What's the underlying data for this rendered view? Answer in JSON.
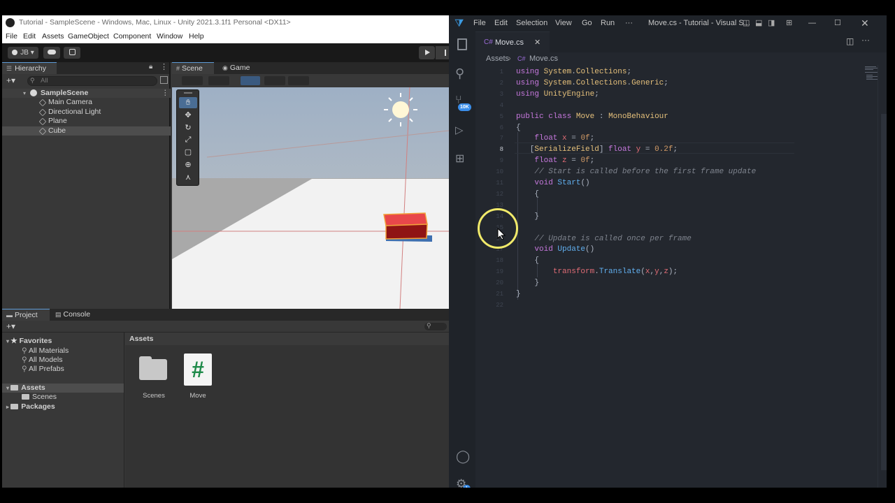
{
  "unity": {
    "title": "Tutorial - SampleScene - Windows, Mac, Linux - Unity 2021.3.1f1 Personal <DX11>",
    "menu": [
      "File",
      "Edit",
      "Assets",
      "GameObject",
      "Component",
      "Window",
      "Help"
    ],
    "account_label": "JB",
    "hierarchy": {
      "tab": "Hierarchy",
      "search_placeholder": "All",
      "scene": "SampleScene",
      "items": [
        "Main Camera",
        "Directional Light",
        "Plane",
        "Cube"
      ],
      "selected": "Cube"
    },
    "scene_tabs": [
      "Scene",
      "Game"
    ],
    "project": {
      "tabs": [
        "Project",
        "Console"
      ],
      "favorites_label": "Favorites",
      "favorites": [
        "All Materials",
        "All Models",
        "All Prefabs"
      ],
      "assets_label": "Assets",
      "asset_folders": [
        "Scenes"
      ],
      "packages_label": "Packages",
      "assets_header": "Assets",
      "asset_items": [
        {
          "name": "Scenes",
          "icon": "folder-icon"
        },
        {
          "name": "Move",
          "icon": "csharp-script-icon"
        }
      ]
    }
  },
  "vscode": {
    "menu": [
      "File",
      "Edit",
      "Selection",
      "View",
      "Go",
      "Run",
      "···"
    ],
    "window_title": "Move.cs - Tutorial - Visual S...",
    "tab_label": "Move.cs",
    "breadcrumb": [
      "Assets",
      "Move.cs"
    ],
    "badge": "10K",
    "settings_badge": "1",
    "current_line": "8",
    "lines": [
      {
        "n": "1",
        "t": "using System.Collections;"
      },
      {
        "n": "2",
        "t": "using System.Collections.Generic;"
      },
      {
        "n": "3",
        "t": "using UnityEngine;"
      },
      {
        "n": "4",
        "t": ""
      },
      {
        "n": "5",
        "t": "public class Move : MonoBehaviour"
      },
      {
        "n": "6",
        "t": "{"
      },
      {
        "n": "7",
        "t": "    float x = 0f;"
      },
      {
        "n": "8",
        "t": "   [SerializeField] float y = 0.2f;"
      },
      {
        "n": "9",
        "t": "    float z = 0f;"
      },
      {
        "n": "10",
        "t": "    // Start is called before the first frame update"
      },
      {
        "n": "11",
        "t": "    void Start()"
      },
      {
        "n": "12",
        "t": "    {"
      },
      {
        "n": "13",
        "t": ""
      },
      {
        "n": "14",
        "t": "    }"
      },
      {
        "n": "15",
        "t": ""
      },
      {
        "n": "16",
        "t": "    // Update is called once per frame"
      },
      {
        "n": "17",
        "t": "    void Update()"
      },
      {
        "n": "18",
        "t": "    {"
      },
      {
        "n": "19",
        "t": "        transform.Translate(x,y,z);"
      },
      {
        "n": "20",
        "t": "    }"
      },
      {
        "n": "21",
        "t": "}"
      },
      {
        "n": "22",
        "t": ""
      }
    ]
  }
}
